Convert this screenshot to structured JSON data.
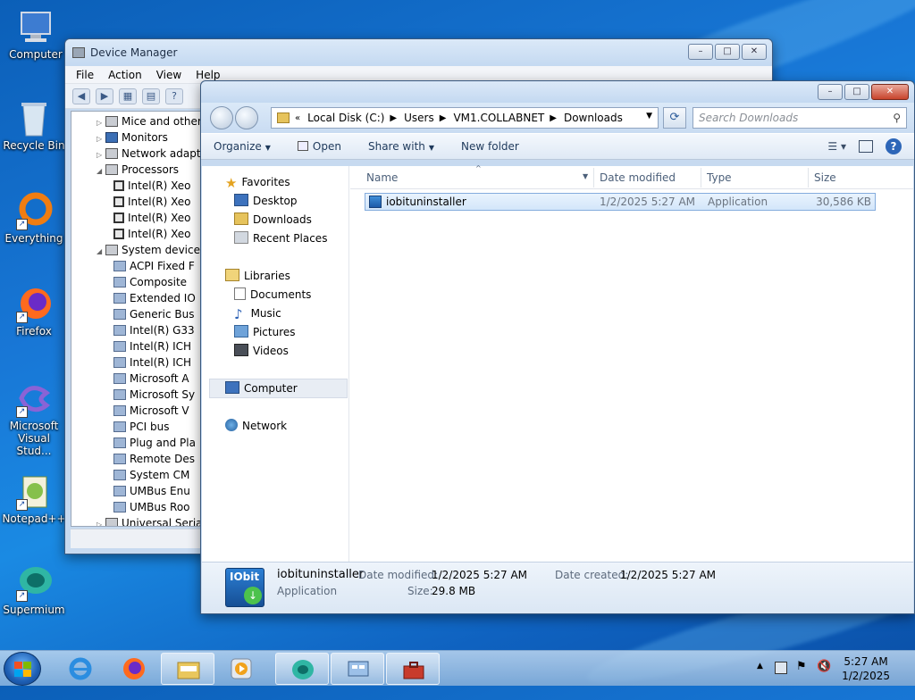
{
  "desktop": {
    "icons": [
      {
        "label": "Computer"
      },
      {
        "label": "Recycle Bin"
      },
      {
        "label": "Everything"
      },
      {
        "label": "Firefox"
      },
      {
        "label": "Microsoft Visual Stud..."
      },
      {
        "label": "Notepad++"
      },
      {
        "label": "Supermium"
      }
    ]
  },
  "devmgr": {
    "title": "Device Manager",
    "menu": [
      "File",
      "Action",
      "View",
      "Help"
    ],
    "tree": [
      {
        "label": "Mice and other",
        "level": 1,
        "exp": "▷"
      },
      {
        "label": "Monitors",
        "level": 1,
        "exp": "▷"
      },
      {
        "label": "Network adapte",
        "level": 1,
        "exp": "▷"
      },
      {
        "label": "Processors",
        "level": 1,
        "exp": "◢"
      },
      {
        "label": "Intel(R) Xeo",
        "level": 2
      },
      {
        "label": "Intel(R) Xeo",
        "level": 2
      },
      {
        "label": "Intel(R) Xeo",
        "level": 2
      },
      {
        "label": "Intel(R) Xeo",
        "level": 2
      },
      {
        "label": "System devices",
        "level": 1,
        "exp": "◢"
      },
      {
        "label": "ACPI Fixed F",
        "level": 2
      },
      {
        "label": "Composite",
        "level": 2
      },
      {
        "label": "Extended IO",
        "level": 2
      },
      {
        "label": "Generic Bus",
        "level": 2
      },
      {
        "label": "Intel(R) G33",
        "level": 2
      },
      {
        "label": "Intel(R) ICH",
        "level": 2
      },
      {
        "label": "Intel(R) ICH",
        "level": 2
      },
      {
        "label": "Microsoft A",
        "level": 2
      },
      {
        "label": "Microsoft Sy",
        "level": 2
      },
      {
        "label": "Microsoft V",
        "level": 2
      },
      {
        "label": "PCI bus",
        "level": 2
      },
      {
        "label": "Plug and Pla",
        "level": 2
      },
      {
        "label": "Remote Des",
        "level": 2
      },
      {
        "label": "System CM",
        "level": 2
      },
      {
        "label": "UMBus Enu",
        "level": 2
      },
      {
        "label": "UMBus Roo",
        "level": 2
      },
      {
        "label": "Universal Serial",
        "level": 1,
        "exp": "▷"
      }
    ]
  },
  "explorer": {
    "address": {
      "segments": [
        "Local Disk (C:)",
        "Users",
        "VM1.COLLABNET",
        "Downloads"
      ],
      "search_placeholder": "Search Downloads"
    },
    "commands": {
      "organize": "Organize",
      "open": "Open",
      "share_with": "Share with",
      "new_folder": "New folder"
    },
    "nav": {
      "favorites": "Favorites",
      "desktop": "Desktop",
      "downloads": "Downloads",
      "recent": "Recent Places",
      "libraries": "Libraries",
      "documents": "Documents",
      "music": "Music",
      "pictures": "Pictures",
      "videos": "Videos",
      "computer": "Computer",
      "network": "Network"
    },
    "columns": {
      "name": "Name",
      "date": "Date modified",
      "type": "Type",
      "size": "Size"
    },
    "files": [
      {
        "name": "iobituninstaller",
        "date": "1/2/2025 5:27 AM",
        "type": "Application",
        "size": "30,586 KB"
      }
    ],
    "details": {
      "name": "iobituninstaller",
      "kind": "Application",
      "modified_label": "Date modified:",
      "modified": "1/2/2025 5:27 AM",
      "created_label": "Date created:",
      "created": "1/2/2025 5:27 AM",
      "size_label": "Size:",
      "size": "29.8 MB",
      "thumb_text": "IObit"
    }
  },
  "taskbar": {
    "time": "5:27 AM",
    "date": "1/2/2025"
  }
}
